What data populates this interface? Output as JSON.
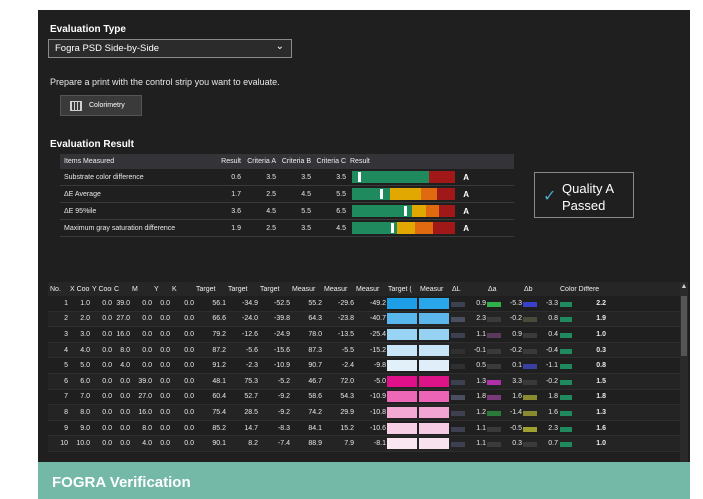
{
  "evaluation_type": {
    "label": "Evaluation Type",
    "selected": "Fogra PSD Side-by-Side"
  },
  "prepare_text": "Prepare a print with the control strip you want to evaluate.",
  "colorimetry_label": "Colorimetry",
  "result": {
    "label": "Evaluation Result",
    "headers": [
      "Items Measured",
      "Result",
      "Criteria A",
      "Criteria B",
      "Criteria C",
      "Result"
    ],
    "rows": [
      {
        "item": "Substrate color difference",
        "result": "0.6",
        "a": "3.5",
        "b": "3.5",
        "c": "3.5",
        "grade": "A",
        "level": 0.06
      },
      {
        "item": "ΔE Average",
        "result": "1.7",
        "a": "2.5",
        "b": "4.5",
        "c": "5.5",
        "grade": "A",
        "level": 0.27
      },
      {
        "item": "ΔE 95%ile",
        "result": "3.6",
        "a": "4.5",
        "b": "5.5",
        "c": "6.5",
        "grade": "A",
        "level": 0.5
      },
      {
        "item": "Maximum gray saturation difference",
        "result": "1.9",
        "a": "2.5",
        "b": "3.5",
        "c": "4.5",
        "grade": "A",
        "level": 0.38
      }
    ],
    "bar_colors": {
      "a": "#1e8a5e",
      "b": "#e0a800",
      "c": "#e06a10",
      "fail": "#a01818"
    }
  },
  "quality": {
    "line1": "Quality A",
    "line2": "Passed",
    "check_color": "#4aa8c8"
  },
  "measure": {
    "headers": [
      "No.",
      "X Coor",
      "Y Coor",
      "C",
      "M",
      "Y",
      "K",
      "Target",
      "Target",
      "Target",
      "Measur",
      "Measur",
      "Measur",
      "Target (",
      "Measur",
      "ΔL",
      "Δa",
      "Δb",
      "Color Differe"
    ],
    "rows": [
      {
        "no": "1",
        "x": "1.0",
        "y": "0.0",
        "c": "39.0",
        "m": "0.0",
        "yy": "0.0",
        "k": "0.0",
        "tl": "56.1",
        "ta": "-34.9",
        "tb": "-52.5",
        "ml": "55.2",
        "ma": "-29.6",
        "mb": "-49.2",
        "tsw": "#1f9ee8",
        "msw": "#2aa6ea",
        "dl": "0.9",
        "dlc": "#3c4050",
        "da": "-5.3",
        "dac": "#30b048",
        "db": "-3.3",
        "dbc": "#3a40c8",
        "de": "2.2",
        "dec": "#1e8a5e"
      },
      {
        "no": "2",
        "x": "2.0",
        "y": "0.0",
        "c": "27.0",
        "m": "0.0",
        "yy": "0.0",
        "k": "0.0",
        "tl": "66.6",
        "ta": "-24.0",
        "tb": "-39.8",
        "ml": "64.3",
        "ma": "-23.8",
        "mb": "-40.7",
        "tsw": "#58b8ee",
        "msw": "#5cb6ec",
        "dl": "2.3",
        "dlc": "#4a4e60",
        "da": "-0.2",
        "dac": "#3a3a3a",
        "db": "0.8",
        "dbc": "#4a4a3a",
        "de": "1.9",
        "dec": "#1e8a5e"
      },
      {
        "no": "3",
        "x": "3.0",
        "y": "0.0",
        "c": "16.0",
        "m": "0.0",
        "yy": "0.0",
        "k": "0.0",
        "tl": "79.2",
        "ta": "-12.6",
        "tb": "-24.9",
        "ml": "78.0",
        "ma": "-13.5",
        "mb": "-25.4",
        "tsw": "#9ad4f4",
        "msw": "#98d2f2",
        "dl": "1.1",
        "dlc": "#3c4050",
        "da": "0.9",
        "dac": "#5a3a5a",
        "db": "0.4",
        "dbc": "#3a3a3a",
        "de": "1.0",
        "dec": "#1e8a5e"
      },
      {
        "no": "4",
        "x": "4.0",
        "y": "0.0",
        "c": "8.0",
        "m": "0.0",
        "yy": "0.0",
        "k": "0.0",
        "tl": "87.2",
        "ta": "-5.6",
        "tb": "-15.6",
        "ml": "87.3",
        "ma": "-5.5",
        "mb": "-15.2",
        "tsw": "#c8e6f8",
        "msw": "#c6e4f6",
        "dl": "-0.1",
        "dlc": "#303030",
        "da": "-0.2",
        "dac": "#3a3a3a",
        "db": "-0.4",
        "dbc": "#3a3a3a",
        "de": "0.3",
        "dec": "#1e8a5e"
      },
      {
        "no": "5",
        "x": "5.0",
        "y": "0.0",
        "c": "4.0",
        "m": "0.0",
        "yy": "0.0",
        "k": "0.0",
        "tl": "91.2",
        "ta": "-2.3",
        "tb": "-10.9",
        "ml": "90.7",
        "ma": "-2.4",
        "mb": "-9.8",
        "tsw": "#e2f0fa",
        "msw": "#e0eefa",
        "dl": "0.5",
        "dlc": "#303030",
        "da": "0.1",
        "dac": "#3a3a3a",
        "db": "-1.1",
        "dbc": "#3a40a0",
        "de": "0.8",
        "dec": "#1e8a5e"
      },
      {
        "no": "6",
        "x": "6.0",
        "y": "0.0",
        "c": "0.0",
        "m": "39.0",
        "yy": "0.0",
        "k": "0.0",
        "tl": "48.1",
        "ta": "75.3",
        "tb": "-5.2",
        "ml": "46.7",
        "ma": "72.0",
        "mb": "-5.0",
        "tsw": "#e0108a",
        "msw": "#dc1488",
        "dl": "1.3",
        "dlc": "#3c4050",
        "da": "3.3",
        "dac": "#b030a8",
        "db": "-0.2",
        "dbc": "#3a3a3a",
        "de": "1.5",
        "dec": "#1e8a5e"
      },
      {
        "no": "7",
        "x": "7.0",
        "y": "0.0",
        "c": "0.0",
        "m": "27.0",
        "yy": "0.0",
        "k": "0.0",
        "tl": "60.4",
        "ta": "52.7",
        "tb": "-9.2",
        "ml": "58.6",
        "ma": "54.3",
        "mb": "-10.9",
        "tsw": "#ee68b8",
        "msw": "#ec64b6",
        "dl": "1.8",
        "dlc": "#4a4e60",
        "da": "1.6",
        "dac": "#7a3a7a",
        "db": "1.8",
        "dbc": "#8a8a30",
        "de": "1.8",
        "dec": "#1e8a5e"
      },
      {
        "no": "8",
        "x": "8.0",
        "y": "0.0",
        "c": "0.0",
        "m": "16.0",
        "yy": "0.0",
        "k": "0.0",
        "tl": "75.4",
        "ta": "28.5",
        "tb": "-9.2",
        "ml": "74.2",
        "ma": "29.9",
        "mb": "-10.8",
        "tsw": "#f4a8d4",
        "msw": "#f2a4d2",
        "dl": "1.2",
        "dlc": "#3c4050",
        "da": "-1.4",
        "dac": "#2a7a3a",
        "db": "1.6",
        "dbc": "#8a8a30",
        "de": "1.3",
        "dec": "#1e8a5e"
      },
      {
        "no": "9",
        "x": "9.0",
        "y": "0.0",
        "c": "0.0",
        "m": "8.0",
        "yy": "0.0",
        "k": "0.0",
        "tl": "85.2",
        "ta": "14.7",
        "tb": "-8.3",
        "ml": "84.1",
        "ma": "15.2",
        "mb": "-10.6",
        "tsw": "#f8d0e6",
        "msw": "#f6cce4",
        "dl": "1.1",
        "dlc": "#3c4050",
        "da": "-0.5",
        "dac": "#3a3a3a",
        "db": "2.3",
        "dbc": "#a0a030",
        "de": "1.6",
        "dec": "#1e8a5e"
      },
      {
        "no": "10",
        "x": "10.0",
        "y": "0.0",
        "c": "0.0",
        "m": "4.0",
        "yy": "0.0",
        "k": "0.0",
        "tl": "90.1",
        "ta": "8.2",
        "tb": "-7.4",
        "ml": "88.9",
        "ma": "7.9",
        "mb": "-8.1",
        "tsw": "#fae6f0",
        "msw": "#f8e2ee",
        "dl": "1.1",
        "dlc": "#3c4050",
        "da": "0.3",
        "dac": "#3a3a3a",
        "db": "0.7",
        "dbc": "#3a3a3a",
        "de": "1.0",
        "dec": "#1e8a5e"
      }
    ]
  },
  "footer_title": "FOGRA Verification"
}
